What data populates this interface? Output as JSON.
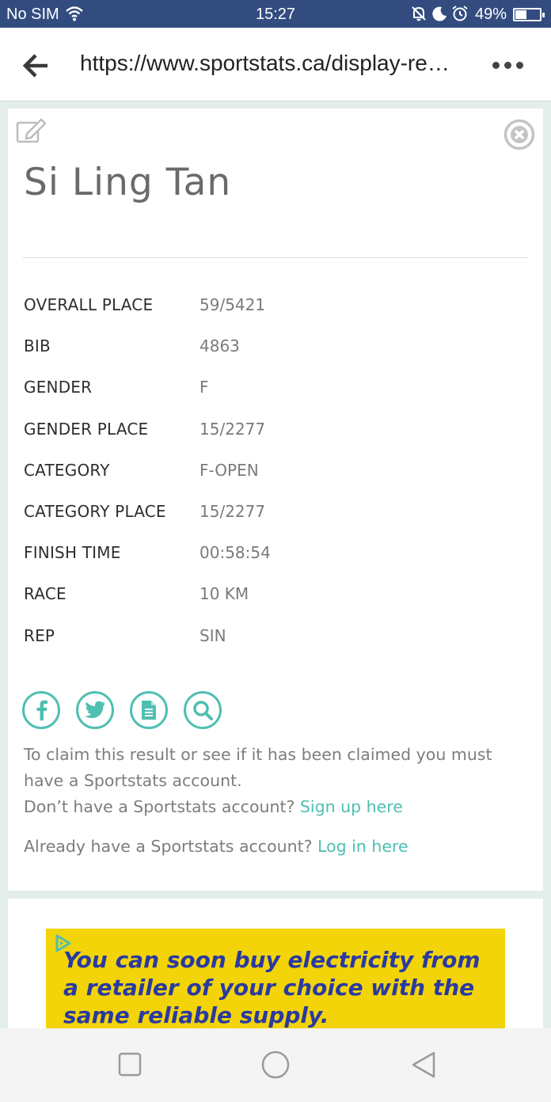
{
  "status_bar": {
    "carrier": "No SIM",
    "time": "15:27",
    "battery_percent": "49%",
    "battery_level": 0.49,
    "icons": [
      "wifi-icon",
      "silent-icon",
      "moon-icon",
      "alarm-icon",
      "battery-icon"
    ]
  },
  "browser": {
    "url": "https://www.sportstats.ca/display-res…",
    "icons": [
      "back-arrow-icon",
      "overflow-menu-icon"
    ]
  },
  "result": {
    "name": "Si Ling Tan",
    "fields": [
      {
        "label": "OVERALL PLACE",
        "value": "59/5421"
      },
      {
        "label": "BIB",
        "value": "4863"
      },
      {
        "label": "GENDER",
        "value": "F"
      },
      {
        "label": "GENDER PLACE",
        "value": "15/2277"
      },
      {
        "label": "CATEGORY",
        "value": "F-OPEN"
      },
      {
        "label": "CATEGORY PLACE",
        "value": "15/2277"
      },
      {
        "label": "FINISH TIME",
        "value": "00:58:54"
      },
      {
        "label": "RACE",
        "value": "10 KM"
      },
      {
        "label": "REP",
        "value": "SIN"
      }
    ],
    "share_icons": [
      "facebook-icon",
      "twitter-icon",
      "document-icon",
      "search-icon"
    ],
    "claim": {
      "text": "To claim this result or see if it has been claimed you must have a Sportstats account.",
      "signup_prompt": "Don’t have a Sportstats account?",
      "signup_link": "Sign up here",
      "login_prompt": "Already have a Sportstats account?",
      "login_link": "Log in here"
    }
  },
  "ad": {
    "text": "You can soon buy electricity from a retailer of your choice with the same reliable supply."
  },
  "colors": {
    "status_bar": "#334c80",
    "accent": "#4fbfb1",
    "page_background": "#e3eeea",
    "ad_background": "#f2d409",
    "ad_text": "#2a3aa0"
  }
}
